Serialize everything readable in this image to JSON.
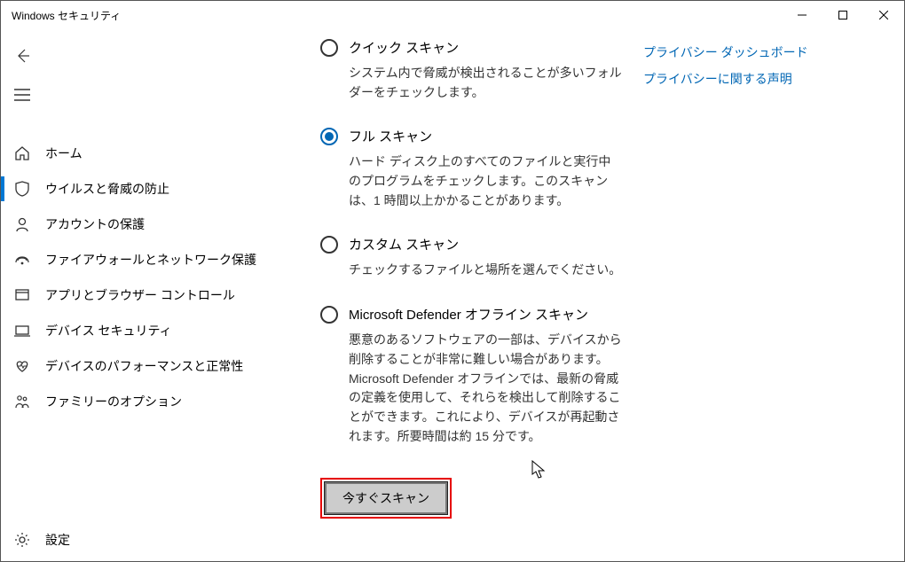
{
  "window": {
    "title": "Windows セキュリティ"
  },
  "nav": {
    "items": [
      {
        "label": "ホーム"
      },
      {
        "label": "ウイルスと脅威の防止"
      },
      {
        "label": "アカウントの保護"
      },
      {
        "label": "ファイアウォールとネットワーク保護"
      },
      {
        "label": "アプリとブラウザー コントロール"
      },
      {
        "label": "デバイス セキュリティ"
      },
      {
        "label": "デバイスのパフォーマンスと正常性"
      },
      {
        "label": "ファミリーのオプション"
      }
    ],
    "settings_label": "設定"
  },
  "scan_options": [
    {
      "title": "クイック スキャン",
      "desc": "システム内で脅威が検出されることが多いフォルダーをチェックします。",
      "selected": false
    },
    {
      "title": "フル スキャン",
      "desc": "ハード ディスク上のすべてのファイルと実行中のプログラムをチェックします。このスキャンは、1 時間以上かかることがあります。",
      "selected": true
    },
    {
      "title": "カスタム スキャン",
      "desc": "チェックするファイルと場所を選んでください。",
      "selected": false
    },
    {
      "title": "Microsoft Defender オフライン スキャン",
      "desc": "悪意のあるソフトウェアの一部は、デバイスから削除することが非常に難しい場合があります。Microsoft Defender オフラインでは、最新の脅威の定義を使用して、それらを検出して削除することができます。これにより、デバイスが再起動されます。所要時間は約 15 分です。",
      "selected": false
    }
  ],
  "scan_now_label": "今すぐスキャン",
  "links": {
    "privacy_dashboard": "プライバシー ダッシュボード",
    "privacy_statement": "プライバシーに関する声明"
  }
}
